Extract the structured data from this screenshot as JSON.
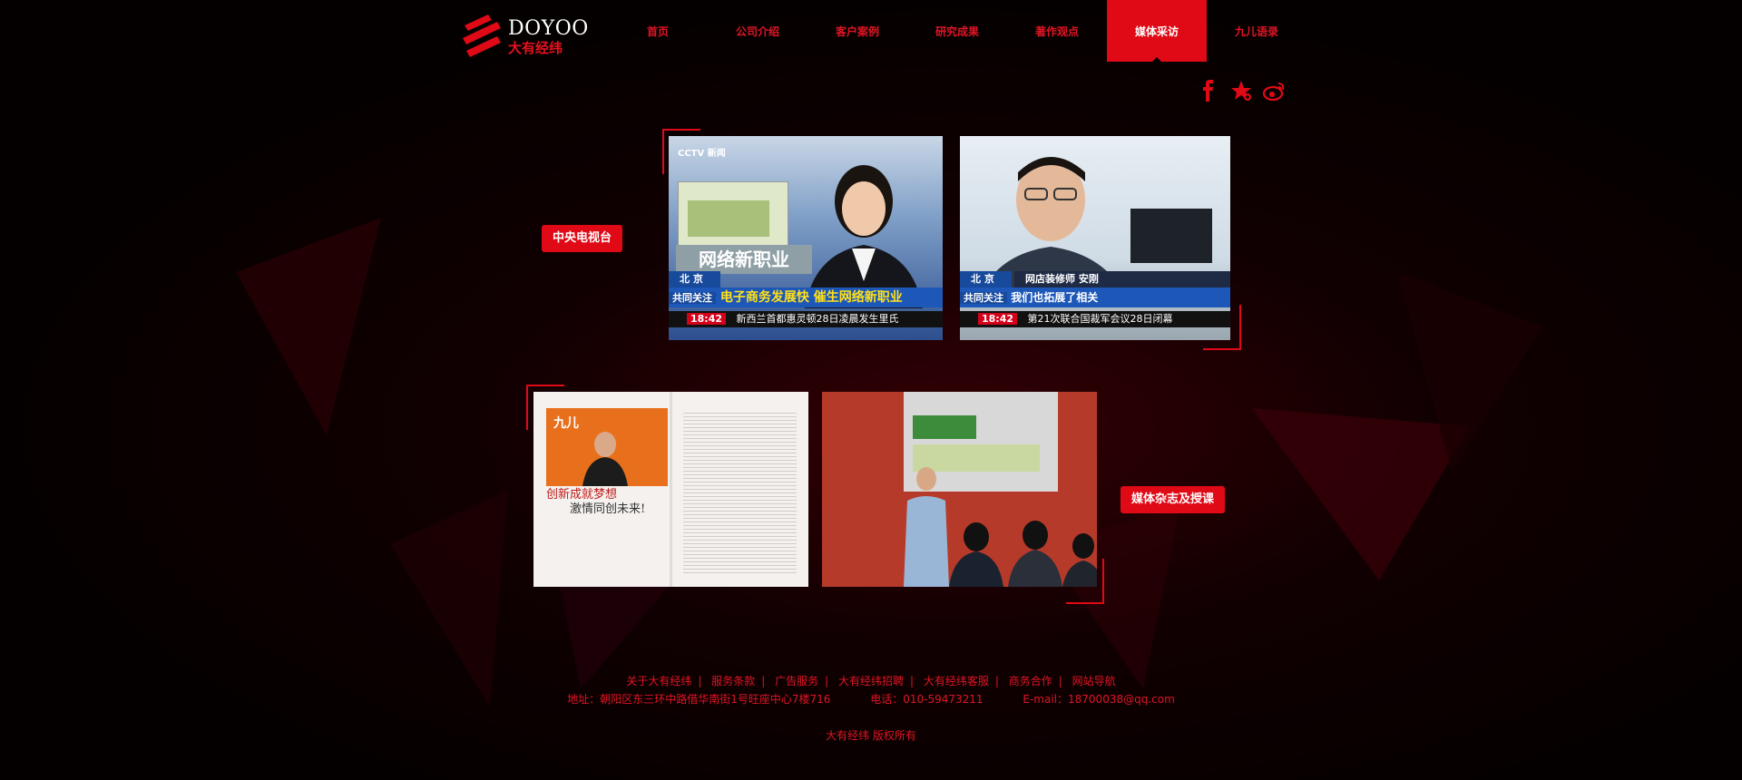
{
  "brand": {
    "name_en": "DOYOO",
    "name_cn": "大有经纬"
  },
  "nav": {
    "items": [
      {
        "label": "首页",
        "active": false
      },
      {
        "label": "公司介绍",
        "active": false
      },
      {
        "label": "客户案例",
        "active": false
      },
      {
        "label": "研究成果",
        "active": false
      },
      {
        "label": "著作观点",
        "active": false
      },
      {
        "label": "媒体采访",
        "active": true
      },
      {
        "label": "九儿语录",
        "active": false
      }
    ]
  },
  "social": [
    "facebook-icon",
    "star-bookmark-icon",
    "weibo-icon"
  ],
  "sections": {
    "cctv": {
      "tag": "中央电视台",
      "photo1": {
        "logo": "CCTV 新闻",
        "title_box": "网络新职业",
        "location": "北 京",
        "headline_prefix": "共同关注",
        "headline": "电子商务发展快 催生网络新职业",
        "time": "18:42",
        "ticker": "新西兰首都惠灵顿28日凌晨发生里氏"
      },
      "photo2": {
        "location": "北 京",
        "name_label": "网店装修师 安刚",
        "headline_prefix": "共同关注",
        "headline": "我们也拓展了相关",
        "time": "18:42",
        "ticker": "第21次联合国裁军会议28日闭幕"
      }
    },
    "magazine": {
      "tag": "媒体杂志及授课",
      "mag_title1": "创新成就梦想",
      "mag_title2": "激情同创未来!",
      "mag_logo": "九儿"
    }
  },
  "footer": {
    "links": [
      "关于大有经纬",
      "服务条款",
      "广告服务",
      "大有经纬招聘",
      "大有经纬客服",
      "商务合作",
      "网站导航"
    ],
    "address": "地址：朝阳区东三环中路借华南街1号旺座中心7楼716",
    "phone": "电话：010-59473211",
    "email": "E-mail：18700038@qq.com",
    "copyright": "大有经纬 版权所有"
  },
  "colors": {
    "accent": "#e00a16",
    "background": "#050000"
  }
}
